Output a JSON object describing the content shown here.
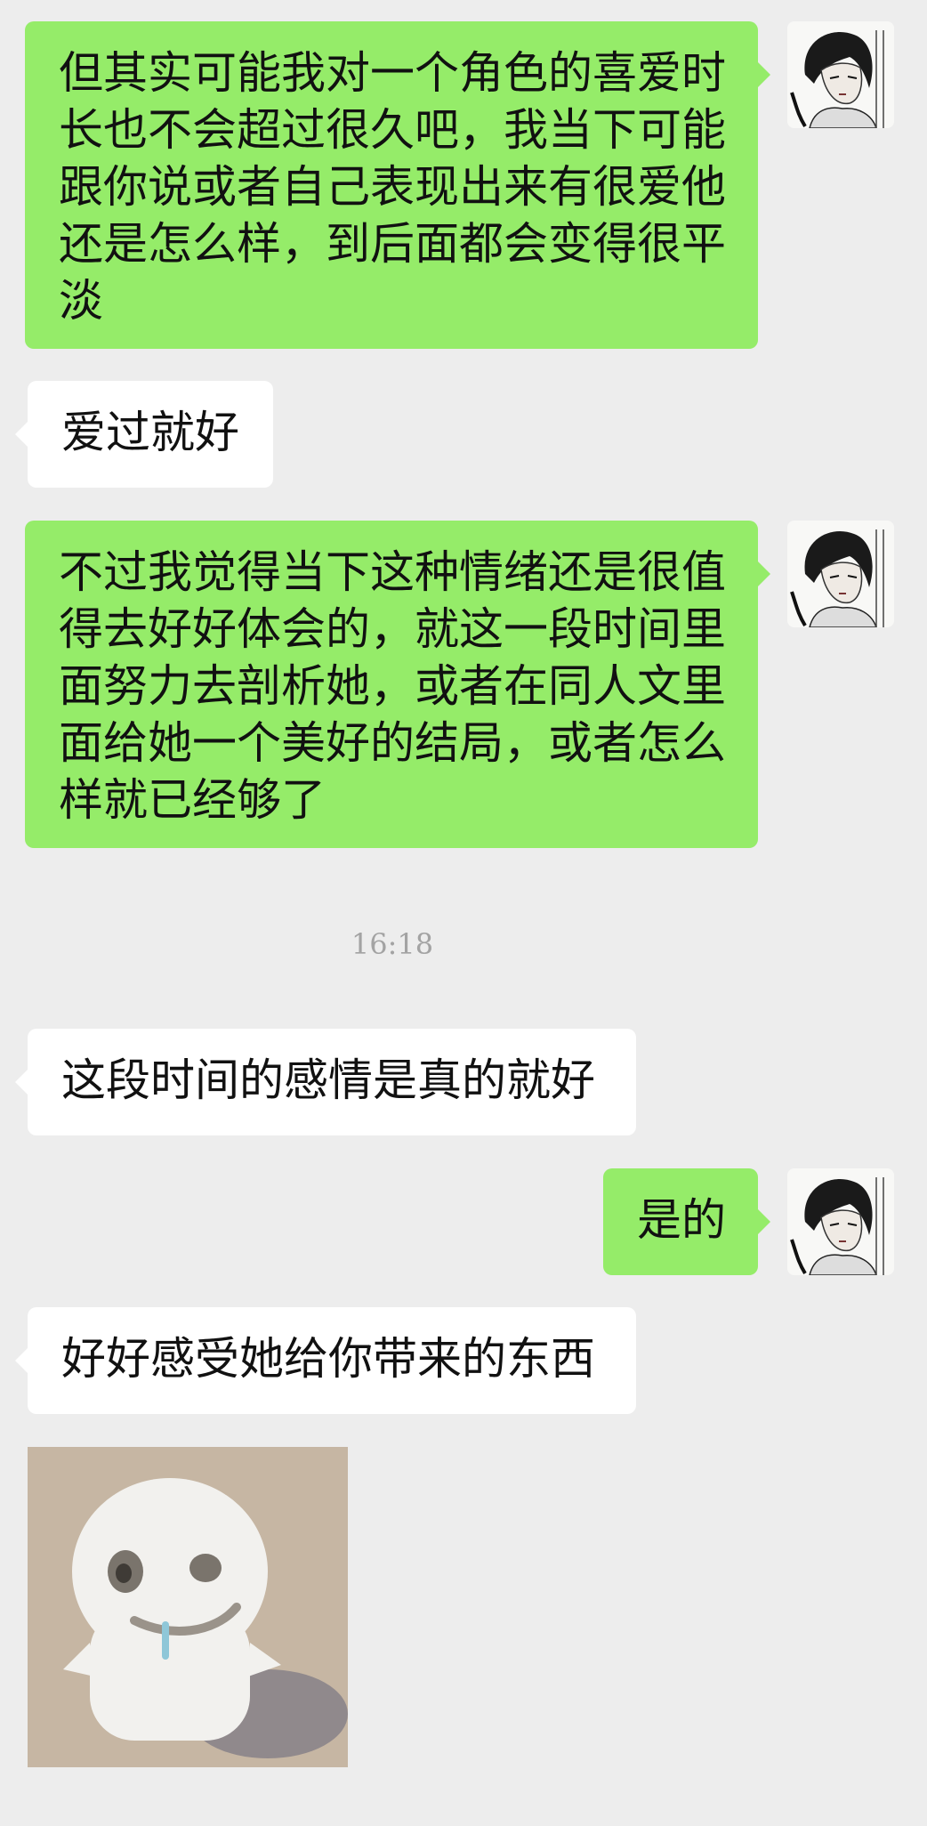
{
  "messages": [
    {
      "side": "me",
      "text": "但其实可能我对一个角色的喜爱时长也不会超过很久吧，我当下可能跟你说或者自己表现出来有很爱他还是怎么样，到后面都会变得很平淡"
    },
    {
      "side": "them",
      "text": "爱过就好"
    },
    {
      "side": "me",
      "text": "不过我觉得当下这种情绪还是很值得去好好体会的，就这一段时间里面努力去剖析她，或者在同人文里面给她一个美好的结局，或者怎么样就已经够了"
    },
    {
      "side": "them",
      "text": "这段时间的感情是真的就好"
    },
    {
      "side": "me",
      "text": "是的"
    },
    {
      "side": "them",
      "text": "好好感受她给你带来的东西"
    }
  ],
  "timestamp": "16:18",
  "icons": {
    "avatar": "avatar-sketch-portrait",
    "sticker": "crying-white-blob-sticker"
  },
  "colors": {
    "background": "#ededed",
    "me_bubble": "#95ec69",
    "them_bubble": "#ffffff",
    "timestamp": "#a3a3a3"
  }
}
